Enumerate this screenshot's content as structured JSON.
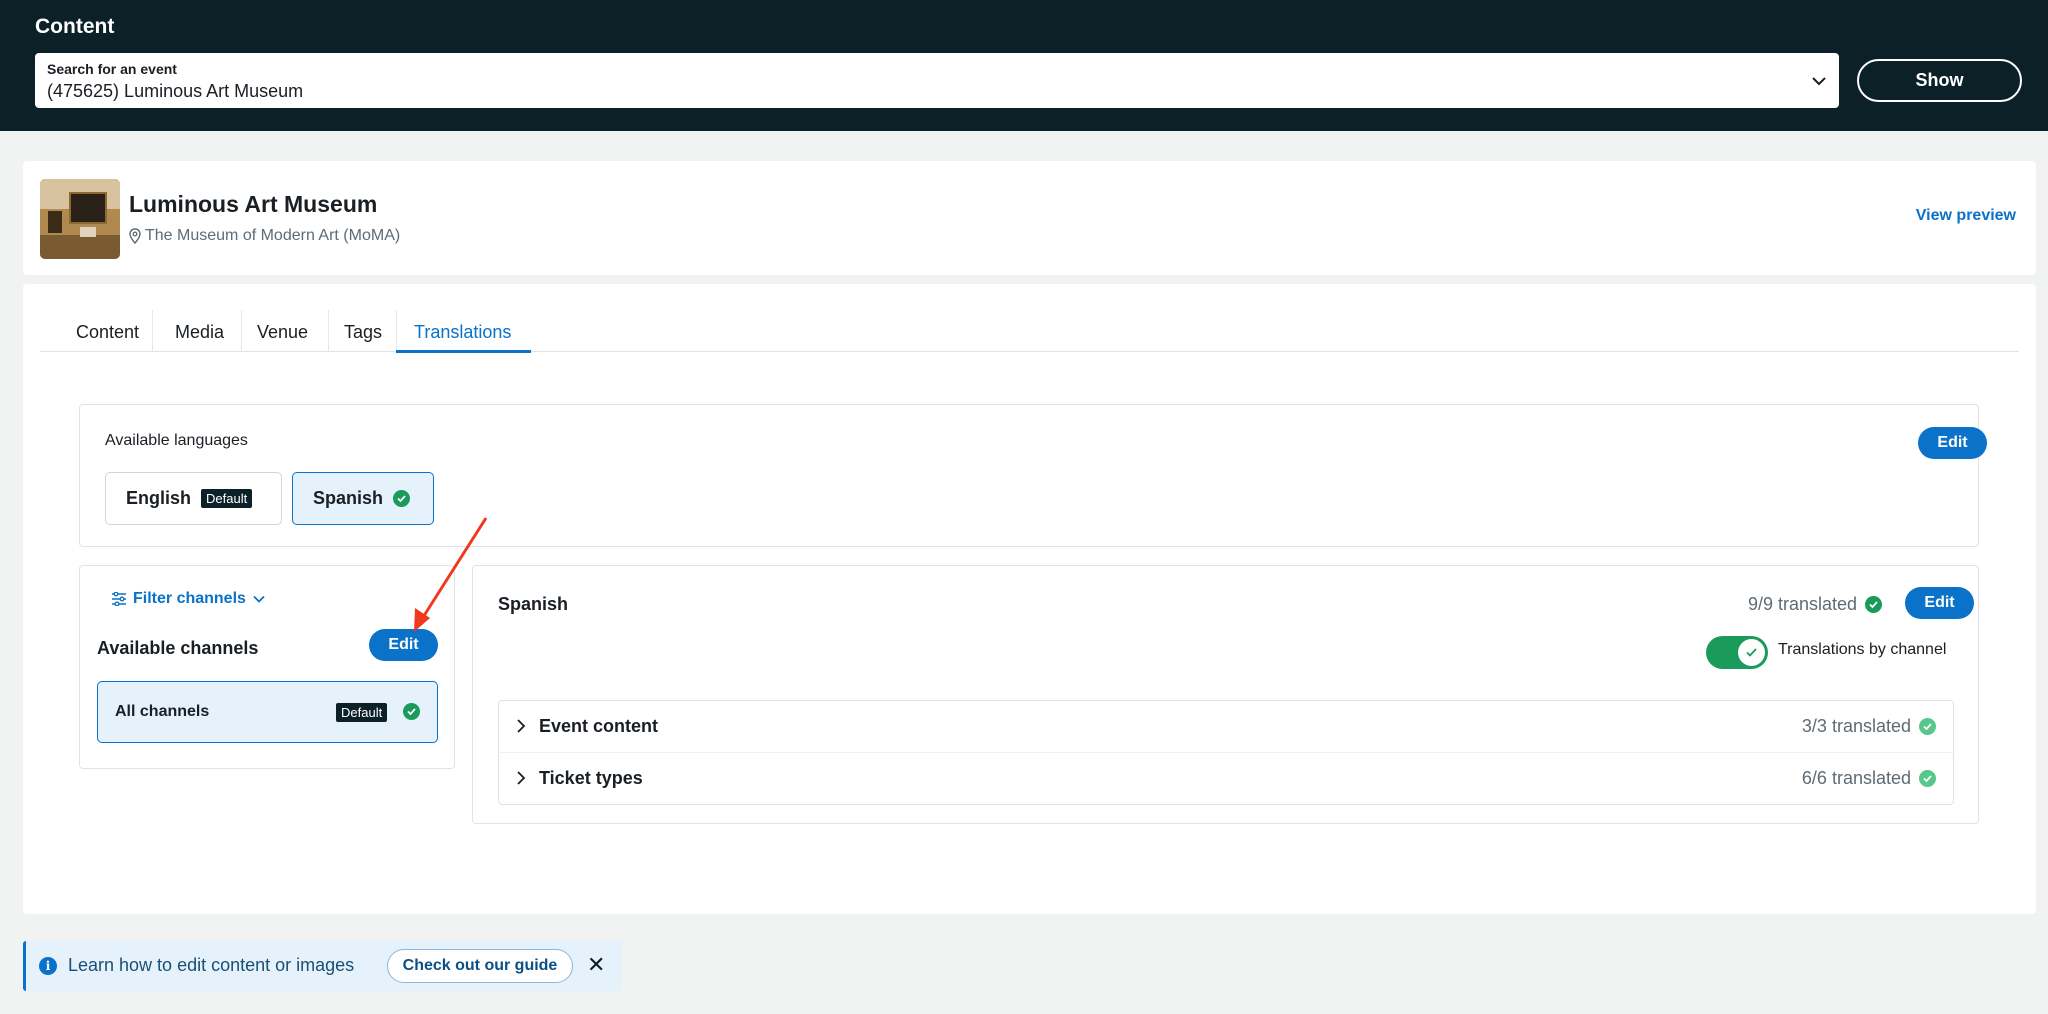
{
  "header": {
    "title": "Content",
    "search": {
      "label": "Search for an event",
      "value": "(475625) Luminous Art Museum"
    },
    "show_label": "Show"
  },
  "event": {
    "name": "Luminous Art Museum",
    "venue": "The Museum of Modern Art (MoMA)",
    "view_preview": "View preview"
  },
  "tabs": [
    {
      "label": "Content",
      "active": false
    },
    {
      "label": "Media",
      "active": false
    },
    {
      "label": "Venue",
      "active": false
    },
    {
      "label": "Tags",
      "active": false
    },
    {
      "label": "Translations",
      "active": true
    }
  ],
  "languages": {
    "title": "Available languages",
    "edit_label": "Edit",
    "items": [
      {
        "label": "English",
        "badge": "Default"
      },
      {
        "label": "Spanish",
        "selected": true
      }
    ]
  },
  "channels": {
    "filter_label": "Filter channels",
    "title": "Available channels",
    "edit_label": "Edit",
    "items": [
      {
        "label": "All channels",
        "badge": "Default"
      }
    ]
  },
  "spanish_panel": {
    "title": "Spanish",
    "status": "9/9 translated",
    "edit_label": "Edit",
    "toggle_label": "Translations by channel",
    "toggle_on": true,
    "sections": [
      {
        "label": "Event content",
        "status": "3/3 translated"
      },
      {
        "label": "Ticket types",
        "status": "6/6 translated"
      }
    ]
  },
  "banner": {
    "text": "Learn how to edit content or images",
    "button_label": "Check out our guide",
    "close_label": "✕"
  },
  "colors": {
    "accent": "#0a72c9",
    "header_bg": "#0c2028",
    "success": "#1a9b5c",
    "annotation_arrow": "#f03a1e"
  }
}
